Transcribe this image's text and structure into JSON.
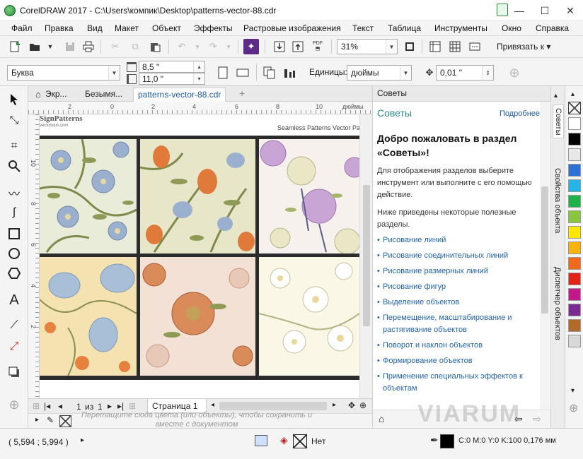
{
  "title_bar": {
    "title": "CorelDRAW 2017 - C:\\Users\\компик\\Desktop\\patterns-vector-88.cdr",
    "minimize": "—",
    "maximize": "☐",
    "close": "✕"
  },
  "menu": [
    "Файл",
    "Правка",
    "Вид",
    "Макет",
    "Объект",
    "Эффекты",
    "Растровые изображения",
    "Текст",
    "Таблица",
    "Инструменты",
    "Окно",
    "Справка"
  ],
  "toolbar": {
    "zoom_value": "31%",
    "snap_label": "Привязать к",
    "pdf_label": "PDF"
  },
  "property_bar": {
    "paper_type": "Буква",
    "width": "8,5 \"",
    "height": "11,0 \"",
    "units_label": "Единицы:",
    "units_value": "дюймы",
    "nudge_value": "0,01 \""
  },
  "doc_tabs": [
    "Экр...",
    "Безымя...",
    "patterns-vector-88.cdr"
  ],
  "ruler": {
    "units": "дюймы",
    "h_ticks": [
      "2",
      "0",
      "2",
      "4",
      "6",
      "8",
      "10"
    ],
    "v_ticks": [
      "10",
      "8",
      "6",
      "4",
      "2"
    ]
  },
  "page_content": {
    "logo_text": "SignPatterns",
    "logo_sub": "vectorious.com",
    "header_text": "Seamless Patterns Vector Pa"
  },
  "page_nav": {
    "current": "1",
    "of_label": "из",
    "total": "1",
    "page_tab": "Страница 1"
  },
  "palette_hint": "Перетащите сюда цвета (или объекты), чтобы сохранить и вместе с документом",
  "docker": {
    "header": "Советы",
    "section_title": "Советы",
    "more_link": "Подробнее",
    "welcome": "Добро пожаловать в раздел «Советы»!",
    "intro": "Для отображения разделов выберите инструмент или выполните с его помощью действие.",
    "intro2": "Ниже приведены некоторые полезные разделы.",
    "links": [
      "Рисование линий",
      "Рисование соединительных линий",
      "Рисование размерных линий",
      "Рисование фигур",
      "Выделение объектов",
      "Перемещение, масштабирование и растягивание объектов",
      "Поворот и наклон объектов",
      "Формирование объектов",
      "Применение специальных эффектов к объектам"
    ]
  },
  "side_tabs": [
    "Советы",
    "Свойства объекта",
    "Диспетчер объектов"
  ],
  "palette_colors": [
    "#ffffff",
    "#000000",
    "#e8e8e8",
    "#2f6fd6",
    "#26b5e5",
    "#1db34a",
    "#8bc53f",
    "#ffe800",
    "#f9b40b",
    "#f06a1e",
    "#e2231a",
    "#c4178a",
    "#7b2d8f",
    "#b06a2c",
    "#d8d8d8"
  ],
  "status": {
    "coords": "( 5,594 ; 5,994 )",
    "fill_label": "Нет",
    "color_readout": "C:0 M:0 Y:0 K:100  0,176 мм"
  },
  "watermark": "VIARUM"
}
